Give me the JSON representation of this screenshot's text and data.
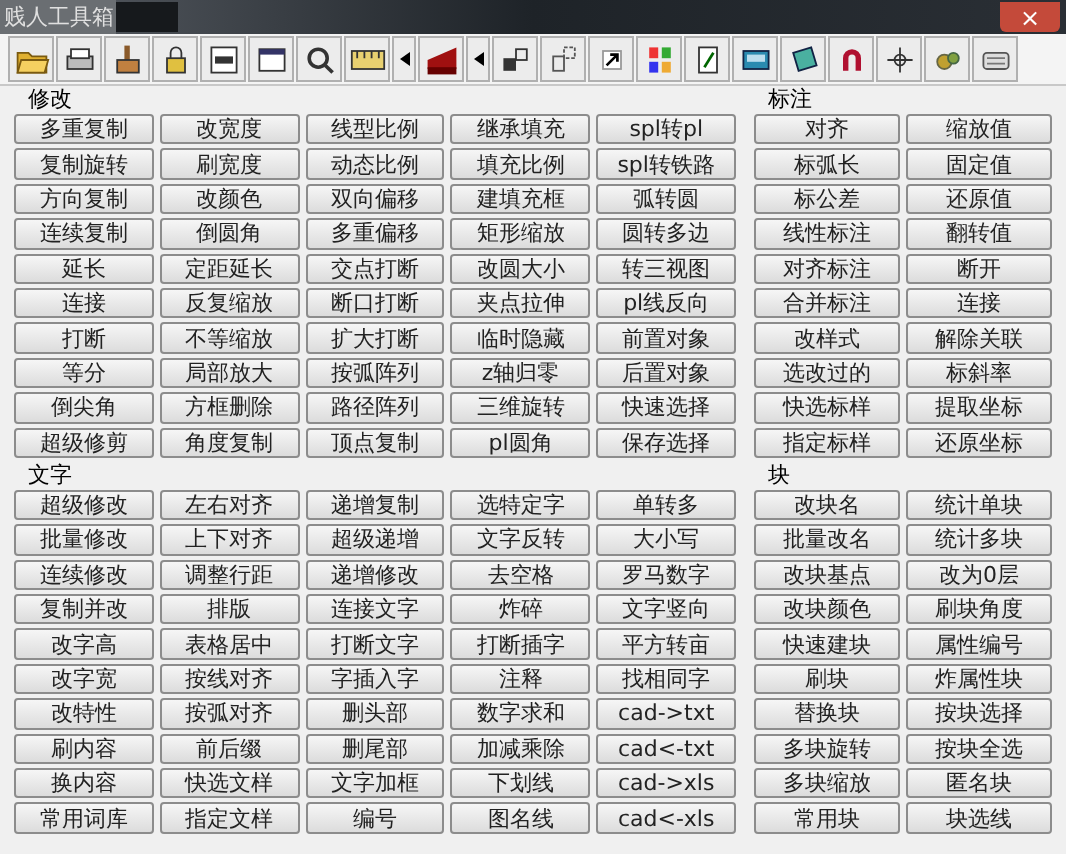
{
  "window": {
    "title": "贱人工具箱",
    "close": "×"
  },
  "toolbar": [
    {
      "kind": "icon"
    },
    {
      "kind": "icon"
    },
    {
      "kind": "icon"
    },
    {
      "kind": "icon"
    },
    {
      "kind": "icon"
    },
    {
      "kind": "icon"
    },
    {
      "kind": "icon"
    },
    {
      "kind": "icon"
    },
    {
      "kind": "dropdown"
    },
    {
      "kind": "icon"
    },
    {
      "kind": "dropdown"
    },
    {
      "kind": "icon"
    },
    {
      "kind": "icon"
    },
    {
      "kind": "icon"
    },
    {
      "kind": "icon"
    },
    {
      "kind": "icon"
    },
    {
      "kind": "icon"
    },
    {
      "kind": "icon"
    },
    {
      "kind": "icon"
    },
    {
      "kind": "icon"
    },
    {
      "kind": "icon"
    },
    {
      "kind": "icon"
    }
  ],
  "left_groups": [
    {
      "title": "修改",
      "buttons": [
        "多重复制",
        "改宽度",
        "线型比例",
        "继承填充",
        "spl转pl",
        "复制旋转",
        "刷宽度",
        "动态比例",
        "填充比例",
        "spl转铁路",
        "方向复制",
        "改颜色",
        "双向偏移",
        "建填充框",
        "弧转圆",
        "连续复制",
        "倒圆角",
        "多重偏移",
        "矩形缩放",
        "圆转多边",
        "延长",
        "定距延长",
        "交点打断",
        "改圆大小",
        "转三视图",
        "连接",
        "反复缩放",
        "断口打断",
        "夹点拉伸",
        "pl线反向",
        "打断",
        "不等缩放",
        "扩大打断",
        "临时隐藏",
        "前置对象",
        "等分",
        "局部放大",
        "按弧阵列",
        "z轴归零",
        "后置对象",
        "倒尖角",
        "方框删除",
        "路径阵列",
        "三维旋转",
        "快速选择",
        "超级修剪",
        "角度复制",
        "顶点复制",
        "pl圆角",
        "保存选择"
      ]
    },
    {
      "title": "文字",
      "buttons": [
        "超级修改",
        "左右对齐",
        "递增复制",
        "选特定字",
        "单转多",
        "批量修改",
        "上下对齐",
        "超级递增",
        "文字反转",
        "大小写",
        "连续修改",
        "调整行距",
        "递增修改",
        "去空格",
        "罗马数字",
        "复制并改",
        "排版",
        "连接文字",
        "炸碎",
        "文字竖向",
        "改字高",
        "表格居中",
        "打断文字",
        "打断插字",
        "平方转亩",
        "改字宽",
        "按线对齐",
        "字插入字",
        "注释",
        "找相同字",
        "改特性",
        "按弧对齐",
        "删头部",
        "数字求和",
        "cad->txt",
        "刷内容",
        "前后缀",
        "删尾部",
        "加减乘除",
        "cad<-txt",
        "换内容",
        "快选文样",
        "文字加框",
        "下划线",
        "cad->xls",
        "常用词库",
        "指定文样",
        "编号",
        "图名线",
        "cad<-xls"
      ]
    }
  ],
  "right_groups": [
    {
      "title": "标注",
      "buttons": [
        "对齐",
        "缩放值",
        "标弧长",
        "固定值",
        "标公差",
        "还原值",
        "线性标注",
        "翻转值",
        "对齐标注",
        "断开",
        "合并标注",
        "连接",
        "改样式",
        "解除关联",
        "选改过的",
        "标斜率",
        "快选标样",
        "提取坐标",
        "指定标样",
        "还原坐标"
      ]
    },
    {
      "title": "块",
      "buttons": [
        "改块名",
        "统计单块",
        "批量改名",
        "统计多块",
        "改块基点",
        "改为0层",
        "改块颜色",
        "刷块角度",
        "快速建块",
        "属性编号",
        "刷块",
        "炸属性块",
        "替换块",
        "按块选择",
        "多块旋转",
        "按块全选",
        "多块缩放",
        "匿名块",
        "常用块",
        "块选线"
      ]
    }
  ]
}
